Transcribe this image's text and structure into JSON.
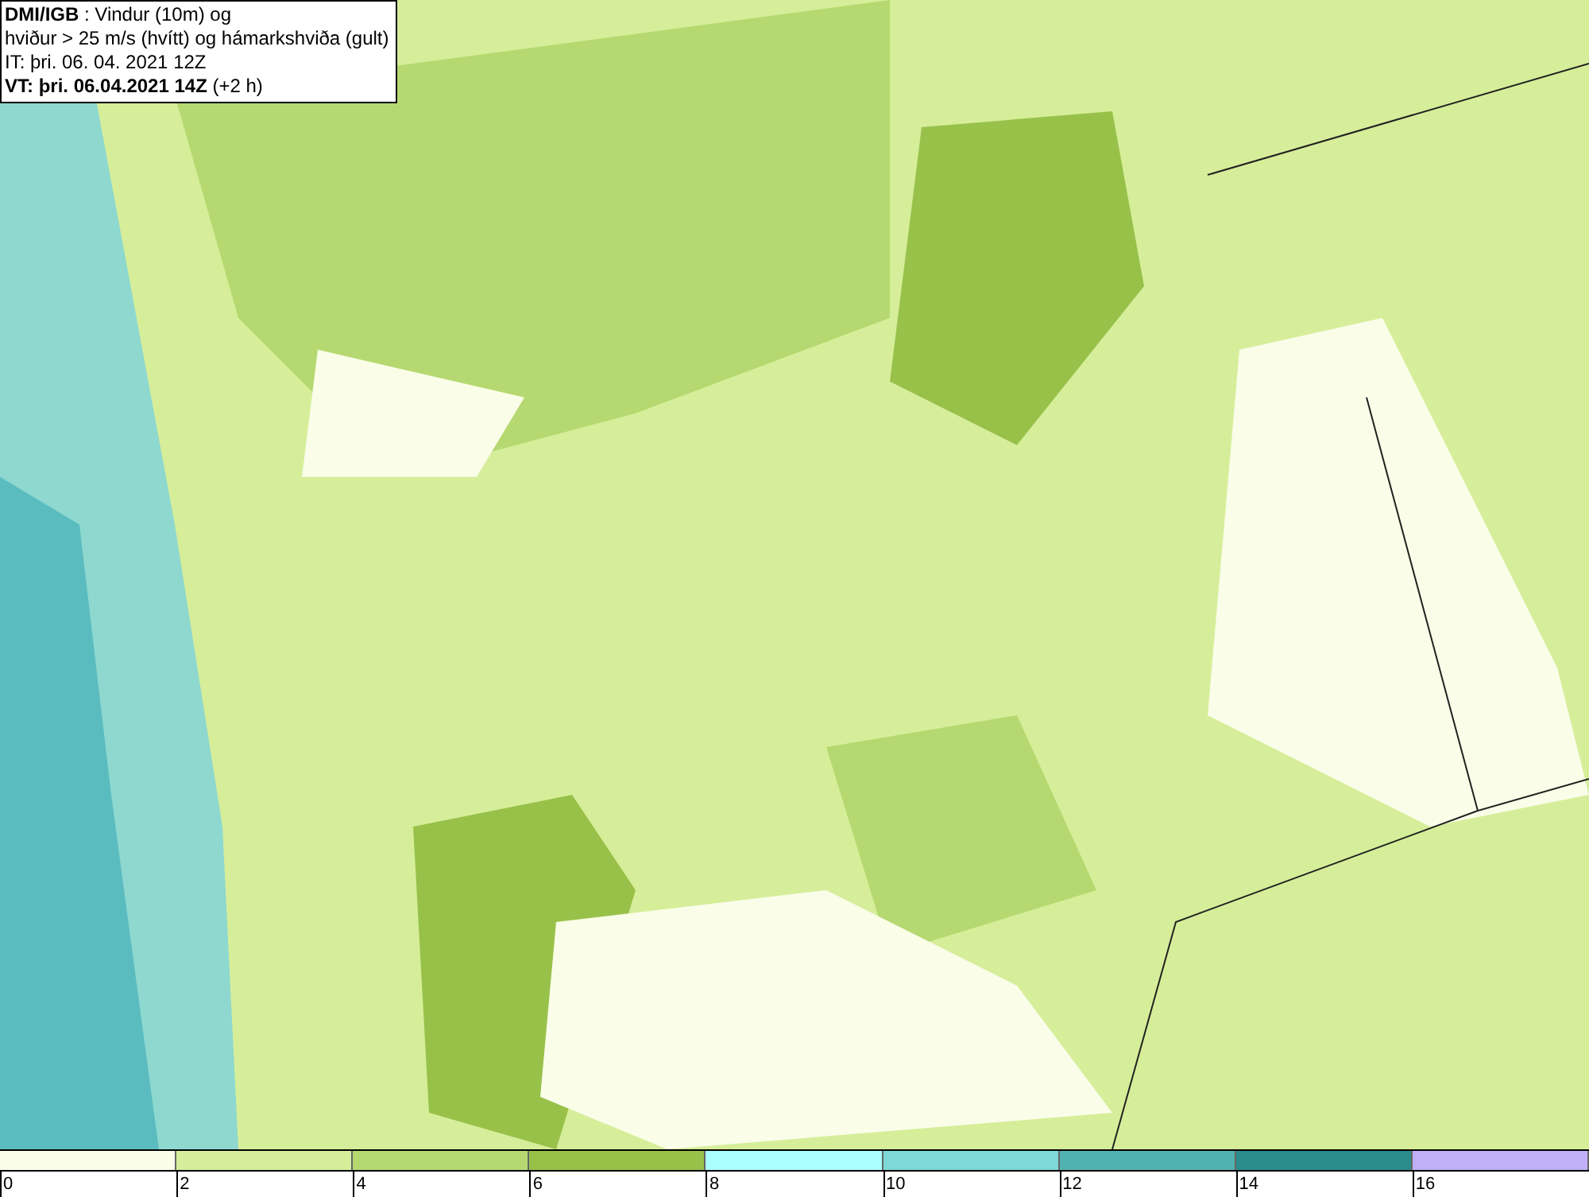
{
  "header": {
    "lines": [
      "**DMI/IGB** : Vindur (10m) og",
      "hviður > 25 m/s (hvítt) og hámarkshviða (gult)",
      "IT: þri. 06. 04. 2021 12Z",
      "**VT: þri. 06.04.2021 14Z** (+2 h)"
    ]
  },
  "legend": {
    "bins": [
      {
        "color": "#fafde8"
      },
      {
        "color": "#d6ee9a"
      },
      {
        "color": "#b5d970"
      },
      {
        "color": "#98c14a"
      },
      {
        "color": "#aaffff"
      },
      {
        "color": "#7ed8d8"
      },
      {
        "color": "#52b2b2"
      },
      {
        "color": "#2a8c8c"
      },
      {
        "color": "#c0b0f8"
      }
    ],
    "ticks": [
      "0",
      "2",
      "4",
      "6",
      "8",
      "10",
      "12",
      "14",
      "16"
    ]
  }
}
